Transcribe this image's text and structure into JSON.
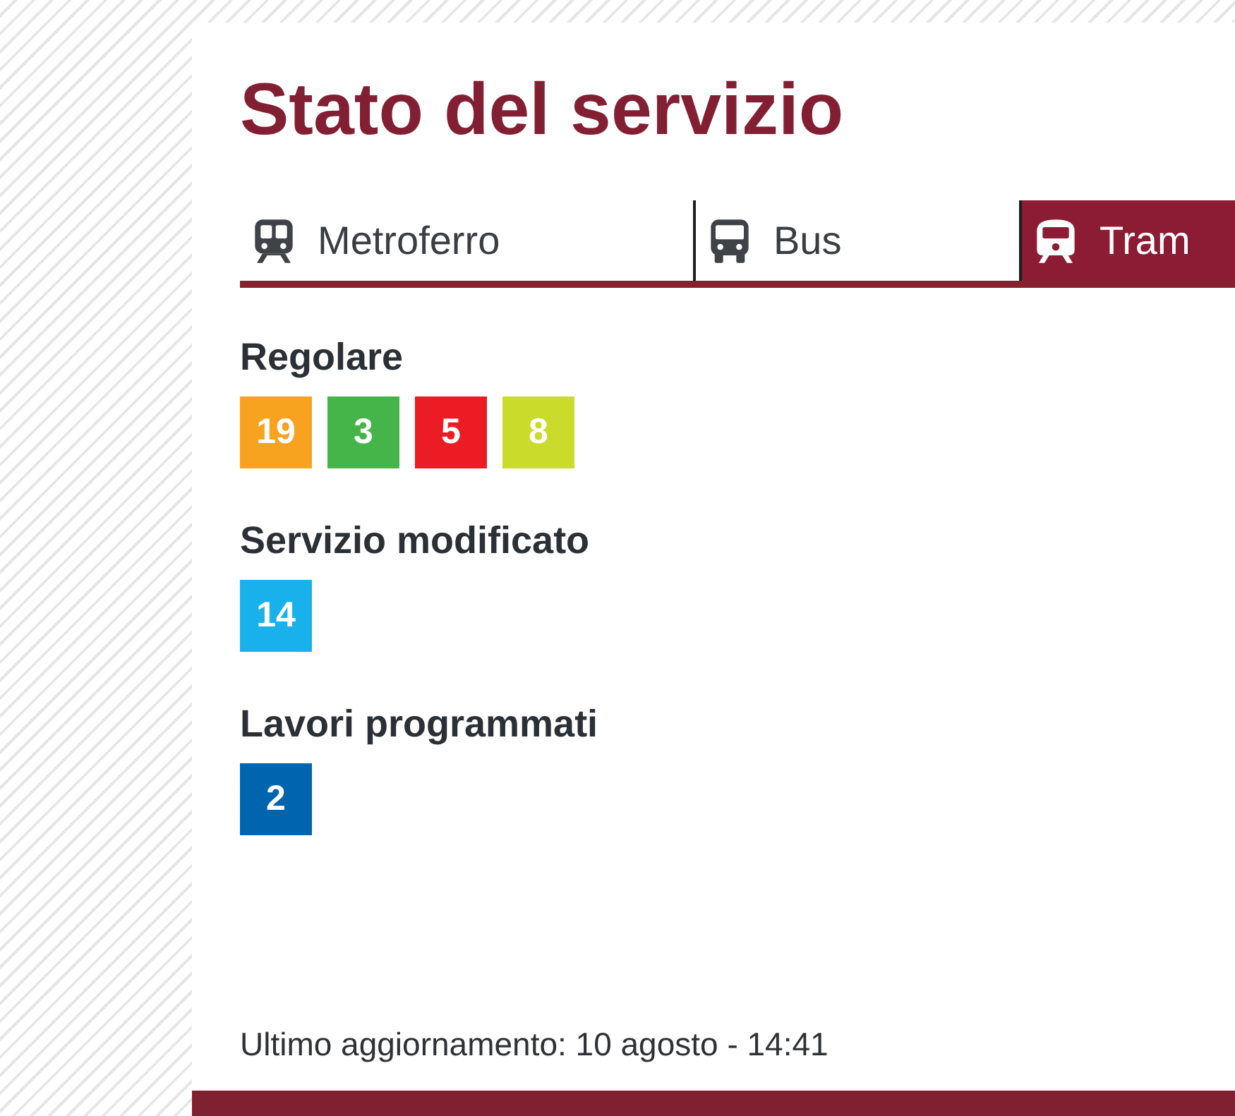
{
  "title": "Stato del servizio",
  "tabs": [
    {
      "label": "Metroferro",
      "kind": "metro",
      "selected": false
    },
    {
      "label": "Bus",
      "kind": "bus",
      "selected": false
    },
    {
      "label": "Tram",
      "kind": "tram",
      "selected": true
    }
  ],
  "sections": [
    {
      "heading": "Regolare",
      "lines": [
        {
          "label": "19",
          "color": "#f7a31f"
        },
        {
          "label": "3",
          "color": "#46b549"
        },
        {
          "label": "5",
          "color": "#ec1c24"
        },
        {
          "label": "8",
          "color": "#cadb2b"
        }
      ]
    },
    {
      "heading": "Servizio modificato",
      "lines": [
        {
          "label": "14",
          "color": "#19b1eb"
        }
      ]
    },
    {
      "heading": "Lavori programmati",
      "lines": [
        {
          "label": "2",
          "color": "#0064ae"
        }
      ]
    }
  ],
  "last_update": "Ultimo aggiornamento: 10 agosto - 14:41"
}
